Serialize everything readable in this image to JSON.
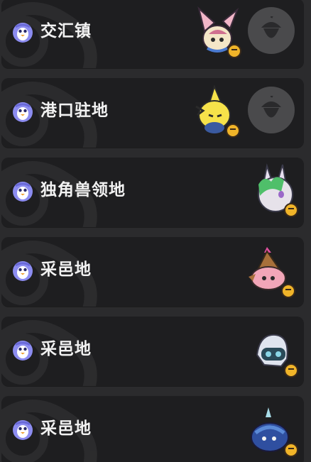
{
  "locations": [
    {
      "label": "交汇镇",
      "creature_icon": "bat-eared-creature-icon",
      "acorn_button": true
    },
    {
      "label": "港口驻地",
      "creature_icon": "yellow-cat-creature-icon",
      "acorn_button": true
    },
    {
      "label": "独角兽领地",
      "creature_icon": "unicorn-creature-icon",
      "acorn_button": false
    },
    {
      "label": "采邑地",
      "creature_icon": "pink-wizard-creature-icon",
      "acorn_button": false
    },
    {
      "label": "采邑地",
      "creature_icon": "ghost-masked-creature-icon",
      "acorn_button": false
    },
    {
      "label": "采邑地",
      "creature_icon": "blue-beetle-creature-icon",
      "acorn_button": false
    }
  ],
  "icons": {
    "badge": "penguin-badge-icon",
    "acorn": "acorn-icon",
    "bell": "bell-icon"
  },
  "colors": {
    "page_bg": "#2b2b2d",
    "card_bg": "#1e1e20",
    "label": "#f2f2f2",
    "badge": "#8c8cf0",
    "acorn_button_bg": "#4a4a4c",
    "bell": "#f0b429"
  }
}
